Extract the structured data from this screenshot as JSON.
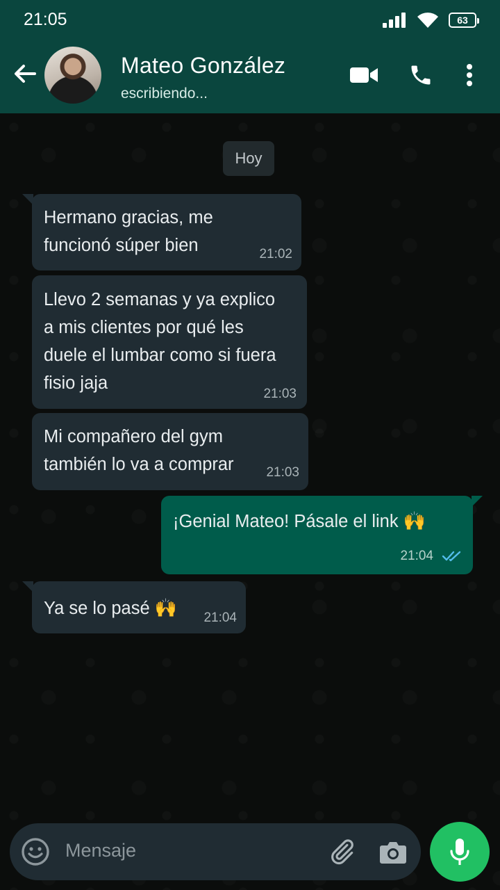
{
  "status_bar": {
    "time": "21:05",
    "battery": "63",
    "icons": [
      "signal-icon",
      "wifi-icon",
      "battery-icon"
    ]
  },
  "header": {
    "contact_name": "Mateo González",
    "contact_status": "escribiendo...",
    "icons": [
      "back-arrow-icon",
      "video-call-icon",
      "phone-icon",
      "more-options-icon"
    ]
  },
  "chat": {
    "date_separator": "Hoy",
    "messages": [
      {
        "direction": "in",
        "text": "Hermano gracias, me\nfuncionó súper bien",
        "time": "21:02"
      },
      {
        "direction": "in",
        "text": "Llevo 2 semanas y ya explico\na mis clientes por qué les\nduele el lumbar como si fuera\nfisio jaja",
        "time": "21:03"
      },
      {
        "direction": "in",
        "text": "Mi compañero del gym\ntambién lo va a comprar",
        "time": "21:03"
      },
      {
        "direction": "out",
        "text": "¡Genial Mateo! Pásale el link",
        "emoji": "🙌",
        "time": "21:04",
        "status": "read"
      },
      {
        "direction": "in",
        "text": "Ya se lo pasé",
        "emoji": "🙌",
        "time": "21:04"
      }
    ]
  },
  "composer": {
    "placeholder": "Mensaje",
    "icons": [
      "emoji-icon",
      "attach-icon",
      "camera-icon",
      "mic-icon"
    ]
  },
  "colors": {
    "header": "#0a463e",
    "incoming_bubble": "#202c33",
    "outgoing_bubble": "#005c4b",
    "mic_button": "#21c063",
    "read_ticks": "#53bdeb"
  }
}
